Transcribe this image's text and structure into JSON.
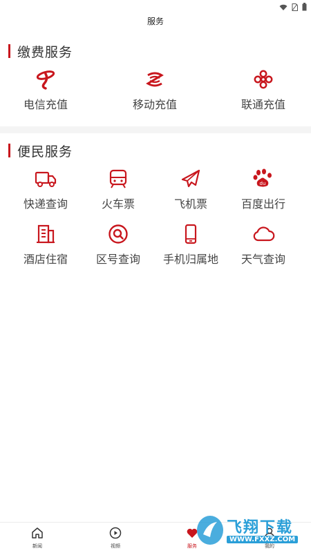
{
  "header": {
    "title": "服务"
  },
  "payment": {
    "title": "缴费服务",
    "items": [
      {
        "label": "电信充值",
        "icon": "china-telecom-icon"
      },
      {
        "label": "移动充值",
        "icon": "china-mobile-icon"
      },
      {
        "label": "联通充值",
        "icon": "china-unicom-icon"
      }
    ]
  },
  "convenience": {
    "title": "便民服务",
    "items": [
      {
        "label": "快递查询",
        "icon": "delivery-truck-icon"
      },
      {
        "label": "火车票",
        "icon": "train-icon"
      },
      {
        "label": "飞机票",
        "icon": "airplane-icon"
      },
      {
        "label": "百度出行",
        "icon": "baidu-paw-icon"
      },
      {
        "label": "酒店住宿",
        "icon": "hotel-building-icon"
      },
      {
        "label": "区号查询",
        "icon": "search-magnifier-icon"
      },
      {
        "label": "手机归属地",
        "icon": "mobile-phone-icon"
      },
      {
        "label": "天气查询",
        "icon": "cloud-icon"
      }
    ]
  },
  "tabbar": {
    "tabs": [
      {
        "label": "新闻",
        "icon": "home-icon",
        "active": false
      },
      {
        "label": "视频",
        "icon": "play-circle-icon",
        "active": false
      },
      {
        "label": "服务",
        "icon": "heart-icon",
        "active": true
      },
      {
        "label": "我的",
        "icon": "user-icon",
        "active": false
      }
    ]
  },
  "watermark": {
    "text": "飞翔下载",
    "url": "WWW.FXXZ.COM"
  },
  "colors": {
    "accent": "#c8161d",
    "watermark": "#2a9fd8"
  }
}
